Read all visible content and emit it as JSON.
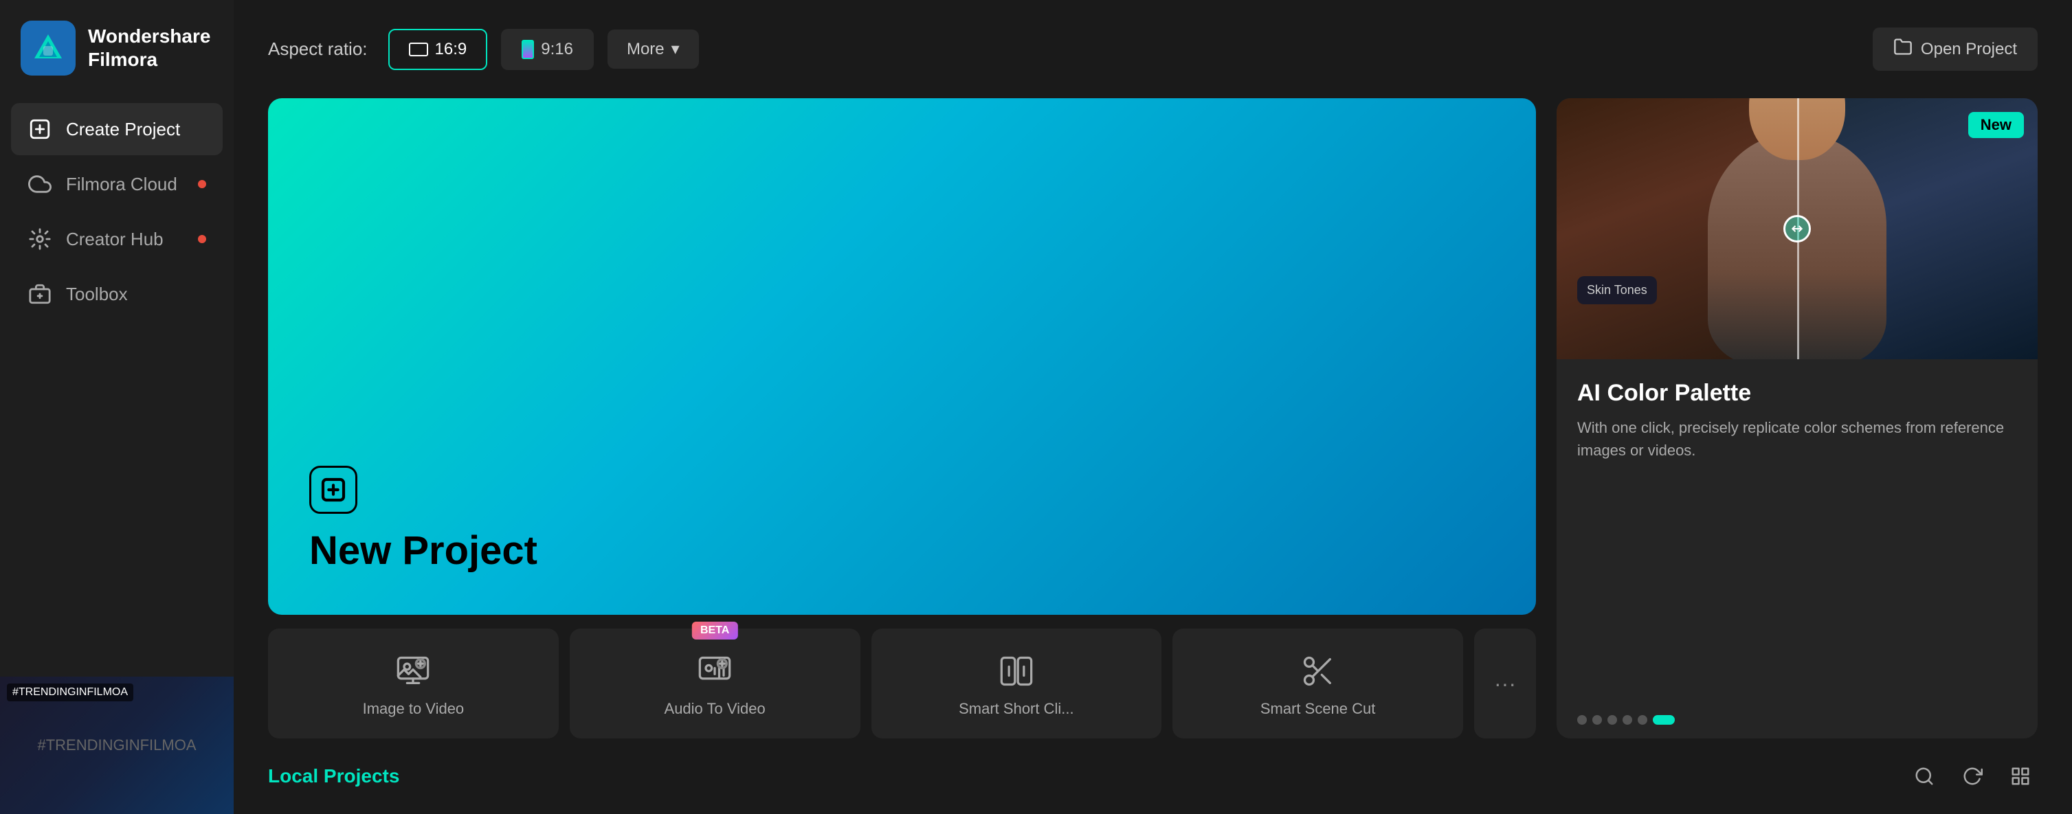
{
  "app": {
    "name": "Wondershare",
    "name2": "Filmora"
  },
  "sidebar": {
    "items": [
      {
        "id": "create-project",
        "label": "Create Project",
        "active": true,
        "dot": false
      },
      {
        "id": "filmora-cloud",
        "label": "Filmora Cloud",
        "active": false,
        "dot": true
      },
      {
        "id": "creator-hub",
        "label": "Creator Hub",
        "active": false,
        "dot": true
      },
      {
        "id": "toolbox",
        "label": "Toolbox",
        "active": false,
        "dot": false
      }
    ]
  },
  "toolbar": {
    "aspect_label": "Aspect ratio:",
    "ratios": [
      {
        "id": "16-9",
        "label": "16:9",
        "active": true
      },
      {
        "id": "9-16",
        "label": "9:16",
        "active": false
      }
    ],
    "more_label": "More",
    "open_project_label": "Open Project"
  },
  "new_project": {
    "label": "New Project"
  },
  "quick_actions": [
    {
      "id": "image-to-video",
      "label": "Image to Video",
      "beta": false
    },
    {
      "id": "audio-to-video",
      "label": "Audio To Video",
      "beta": true
    },
    {
      "id": "smart-short-cli",
      "label": "Smart Short Cli...",
      "beta": false
    },
    {
      "id": "smart-scene-cut",
      "label": "Smart Scene Cut",
      "beta": false
    }
  ],
  "feature_panel": {
    "new_badge": "New",
    "title": "AI Color Palette",
    "description": "With one click, precisely replicate color schemes from reference images or videos.",
    "dots": [
      1,
      2,
      3,
      4,
      5,
      6
    ],
    "active_dot": 6
  },
  "local_projects": {
    "label": "Local Projects"
  }
}
